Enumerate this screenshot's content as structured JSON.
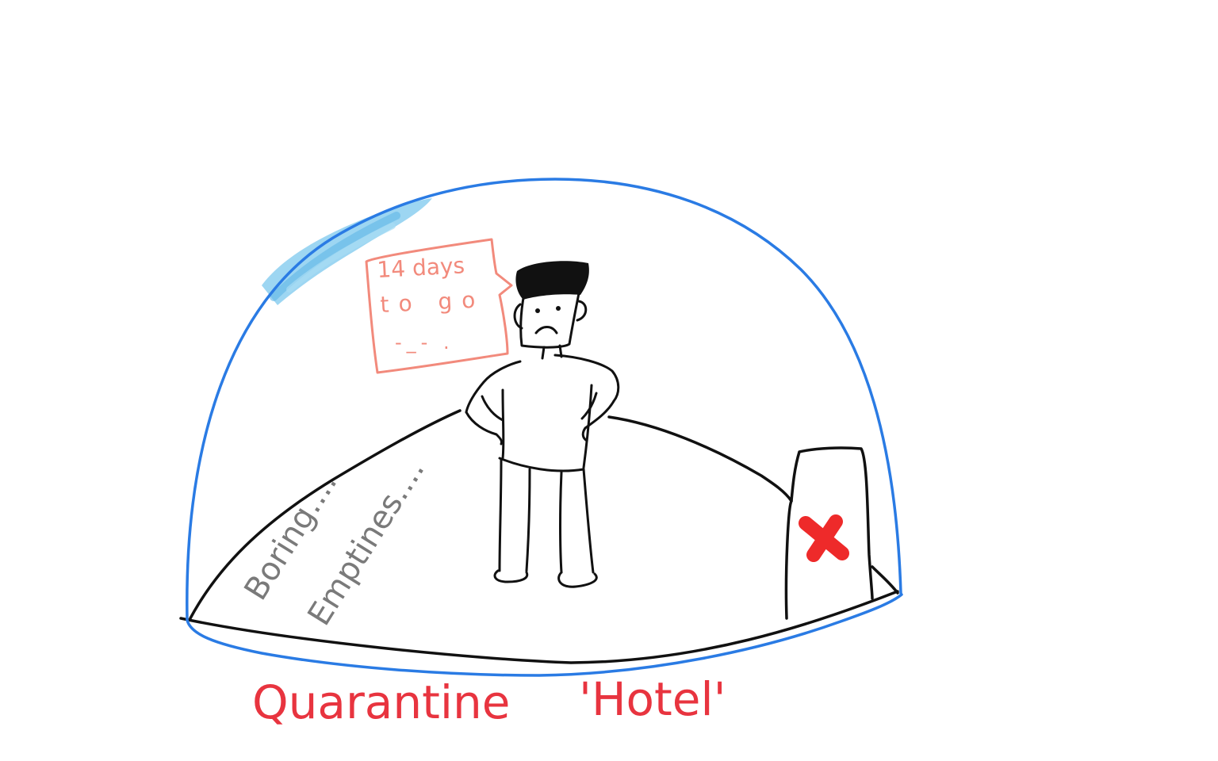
{
  "illustration": {
    "speech_bubble": {
      "line1": "14 days",
      "line2": "to go",
      "face": "-_- ."
    },
    "floor_notes": {
      "boring": "Boring....",
      "emptiness": "Emptines...."
    },
    "caption": {
      "word1": "Quarantine",
      "word2": "'Hotel'"
    },
    "colors": {
      "dome": "#2a7be4",
      "dome_highlight": "#7cc8ee",
      "ink": "#111111",
      "bubble": "#f28a7c",
      "floor_notes": "#7a7a7a",
      "caption": "#e8343f",
      "red_cross": "#ee2a2a"
    }
  }
}
